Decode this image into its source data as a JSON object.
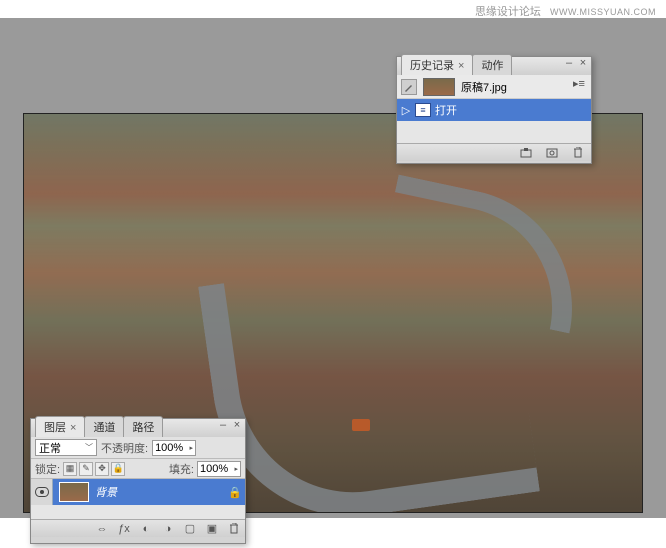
{
  "watermark": {
    "site": "思缘设计论坛",
    "url": "WWW.MISSYUAN.COM"
  },
  "history_panel": {
    "tabs": [
      {
        "label": "历史记录",
        "active": true
      },
      {
        "label": "动作",
        "active": false
      }
    ],
    "document_name": "原稿7.jpg",
    "items": [
      {
        "label": "打开",
        "selected": true
      }
    ]
  },
  "layers_panel": {
    "tabs": [
      {
        "label": "图层",
        "active": true
      },
      {
        "label": "通道",
        "active": false
      },
      {
        "label": "路径",
        "active": false
      }
    ],
    "blend_mode": "正常",
    "opacity_label": "不透明度:",
    "opacity_value": "100%",
    "lock_label": "锁定:",
    "fill_label": "填充:",
    "fill_value": "100%",
    "layers": [
      {
        "name": "背景",
        "visible": true,
        "locked": true
      }
    ]
  }
}
